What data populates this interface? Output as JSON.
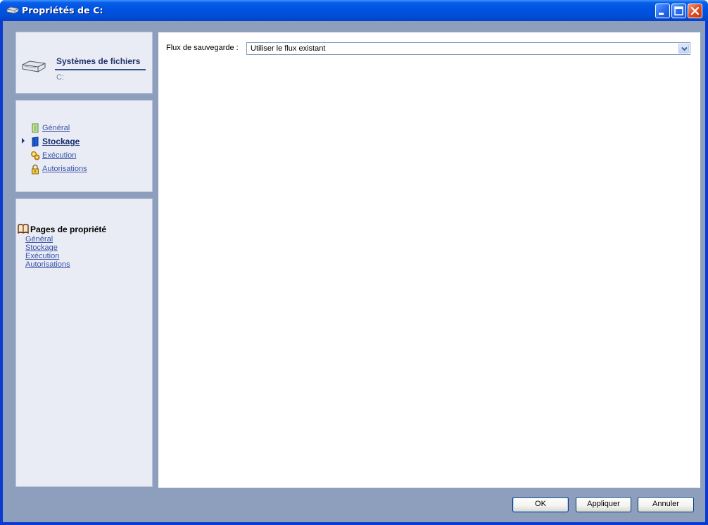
{
  "window": {
    "title": "Propriétés de C:",
    "title_icon": "drive-icon",
    "controls": [
      "minimize-icon",
      "maximize-icon",
      "close-icon"
    ]
  },
  "header_panel": {
    "title": "Systèmes de fichiers",
    "subtitle": "C:",
    "icon": "hard-drive-icon"
  },
  "nav": {
    "items": [
      {
        "label": "Général",
        "icon": "document-icon",
        "active": false
      },
      {
        "label": "Stockage",
        "icon": "storage-icon",
        "active": true
      },
      {
        "label": "Exécution",
        "icon": "execution-gears-icon",
        "active": false
      },
      {
        "label": "Autorisations",
        "icon": "lock-icon",
        "active": false
      }
    ]
  },
  "property_pages": {
    "title": "Pages de propriété",
    "icon": "book-icon",
    "links": [
      "Général",
      "Stockage",
      "Exécution",
      "Autorisations"
    ]
  },
  "main": {
    "field_label": "Flux de sauvegarde :",
    "field_value": "Utiliser le flux existant"
  },
  "buttons": {
    "ok": "OK",
    "apply": "Appliquer",
    "cancel": "Annuler"
  },
  "colors": {
    "titlebar": "#0054e3",
    "client_background": "#8d9fbc",
    "panel_background": "#e9ecf4",
    "link": "#3a53a8"
  }
}
